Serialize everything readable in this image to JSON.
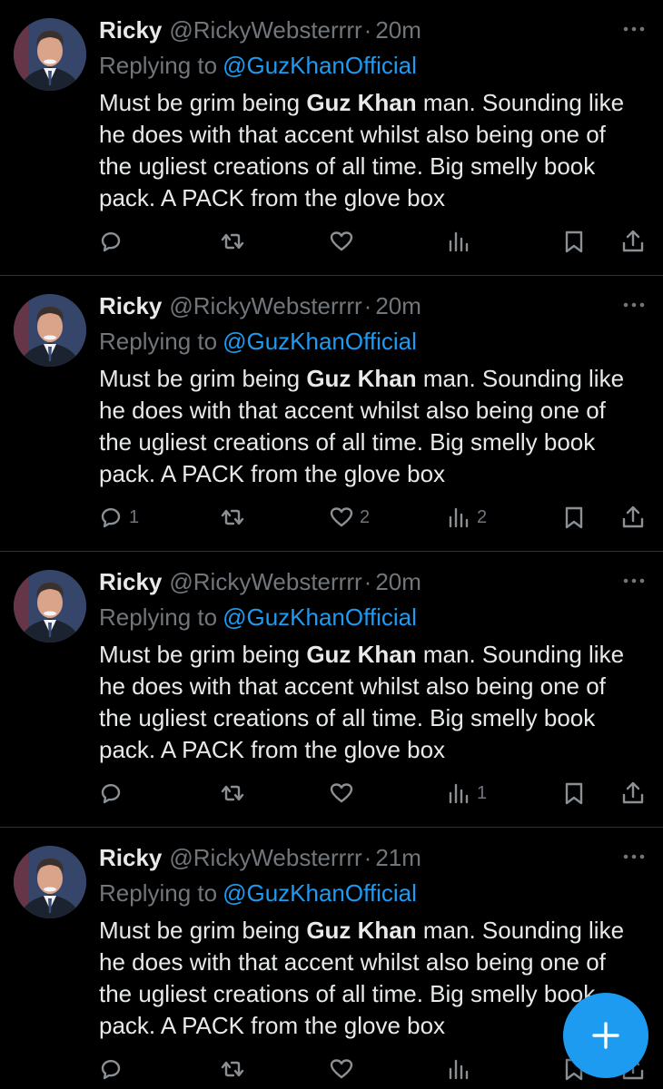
{
  "colors": {
    "background": "#000000",
    "accent": "#1d9bf0",
    "muted": "#71767b",
    "text": "#e7e9ea"
  },
  "tweets": [
    {
      "name": "Ricky",
      "handle": "@RickyWebsterrrr",
      "dot": "·",
      "time": "20m",
      "replying_prefix": "Replying to",
      "mention": "@GuzKhanOfficial",
      "text_lines": [
        "Must be grim being ",
        "Guz Khan",
        " man. Sounding like",
        "he does with that accent whilst also being one of",
        "the ugliest creations of all time. Big smelly book",
        "pack. A PACK from the glove box"
      ],
      "replies": "",
      "retweets": "",
      "likes": "",
      "views": ""
    },
    {
      "name": "Ricky",
      "handle": "@RickyWebsterrrr",
      "dot": "·",
      "time": "20m",
      "replying_prefix": "Replying to",
      "mention": "@GuzKhanOfficial",
      "text_lines": [
        "Must be grim being ",
        "Guz Khan",
        " man. Sounding like",
        "he does with that accent whilst also being one of",
        "the ugliest creations of all time. Big smelly book",
        "pack. A PACK from the glove box"
      ],
      "replies": "1",
      "retweets": "",
      "likes": "2",
      "views": "2"
    },
    {
      "name": "Ricky",
      "handle": "@RickyWebsterrrr",
      "dot": "·",
      "time": "20m",
      "replying_prefix": "Replying to",
      "mention": "@GuzKhanOfficial",
      "text_lines": [
        "Must be grim being ",
        "Guz Khan",
        " man. Sounding like",
        "he does with that accent whilst also being one of",
        "the ugliest creations of all time. Big smelly book",
        "pack. A PACK from the glove box"
      ],
      "replies": "",
      "retweets": "",
      "likes": "",
      "views": "1"
    },
    {
      "name": "Ricky",
      "handle": "@RickyWebsterrrr",
      "dot": "·",
      "time": "21m",
      "replying_prefix": "Replying to",
      "mention": "@GuzKhanOfficial",
      "text_lines": [
        "Must be grim being ",
        "Guz Khan",
        " man. Sounding like",
        "he does with that accent whilst also being one of",
        "the ugliest creations of all time. Big smelly book",
        "pack. A PACK from the glove box"
      ],
      "replies": "",
      "retweets": "",
      "likes": "",
      "views": ""
    }
  ],
  "icons": {
    "avatar": "profile-photo",
    "more": "more-dots-icon",
    "reply": "reply-bubble-icon",
    "retweet": "retweet-icon",
    "like": "heart-icon",
    "views": "views-bars-icon",
    "bookmark": "bookmark-icon",
    "share": "share-icon",
    "compose": "plus-icon"
  }
}
